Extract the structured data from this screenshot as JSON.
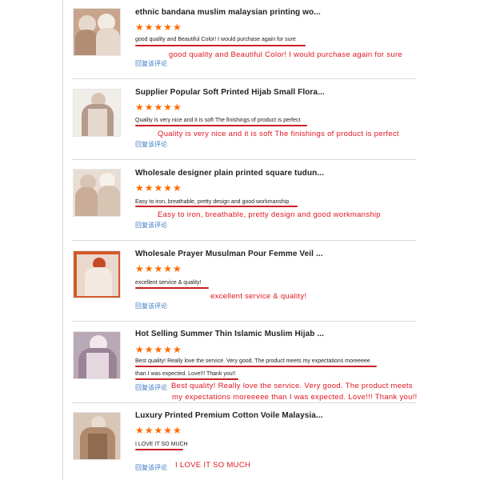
{
  "reviews": [
    {
      "title": "ethnic bandana muslim malaysian printing wo...",
      "stars": "★★★★★",
      "comment_lines": [
        "good quality and Beautiful Color! I would purchase again for sure"
      ],
      "reply": "回复该评论",
      "annotation_lines": [
        "good quality and Beautiful Color! I would purchase again for sure"
      ],
      "thumb_colors": {
        "bg": "#c9a58d",
        "a": "#e7d8cc",
        "b": "#b08d74",
        "c": "#f2ebe4"
      }
    },
    {
      "title": "Supplier Popular Soft Printed Hijab Small Flora...",
      "stars": "★★★★★",
      "comment_lines": [
        "Quality is very nice and it is soft The finishings of product is perfect"
      ],
      "reply": "回复该评论",
      "annotation_lines": [
        "Quality is very nice and it is soft The finishings of product is perfect"
      ],
      "thumb_colors": {
        "bg": "#f1ede8",
        "a": "#d7c4b7",
        "b": "#b59b8c",
        "c": "#ffffff"
      }
    },
    {
      "title": "Wholesale designer plain printed square tudun...",
      "stars": "★★★★★",
      "comment_lines": [
        "Easy to iron, breathable, pretty design and good workmanship"
      ],
      "reply": "回复该评论",
      "annotation_lines": [
        "Easy to iron, breathable, pretty design and good workmanship"
      ],
      "thumb_colors": {
        "bg": "#e9ddd3",
        "a": "#c9ad98",
        "b": "#d8c4b3",
        "c": "#f7f1ec"
      }
    },
    {
      "title": "Wholesale Prayer Musulman Pour Femme Veil ...",
      "stars": "★★★★★",
      "comment_lines": [
        "excellent service & quality!"
      ],
      "reply": "回复该评论",
      "annotation_lines": [
        "excellent service & quality!"
      ],
      "thumb_colors": {
        "bg": "#d25a2d",
        "a": "#f3e9e1",
        "b": "#c44a24",
        "c": "#e9d8cc"
      }
    },
    {
      "title": "Hot Selling Summer Thin Islamic Muslim Hijab ...",
      "stars": "★★★★★",
      "comment_lines": [
        "Best quality! Really love the service. Very good. The product meets my expectations moreeeee",
        "than I was expected. Love!!! Thank you!!"
      ],
      "reply": "回复该评论",
      "annotation_lines": [
        "Best quality! Really love the service. Very good. The product meets",
        "my expectations moreeeee than I was expected. Love!!! Thank you!!"
      ],
      "thumb_colors": {
        "bg": "#b9a9b6",
        "a": "#e4d7df",
        "b": "#9a8396",
        "c": "#f2e8ed"
      }
    },
    {
      "title": "Luxury Printed Premium Cotton Voile Malaysia...",
      "stars": "★★★★★",
      "comment_lines": [
        "I LOVE IT SO MUCH"
      ],
      "reply": "回复该评论",
      "annotation_lines": [
        "I LOVE IT SO MUCH"
      ],
      "thumb_colors": {
        "bg": "#d8c6b6",
        "a": "#b08a6d",
        "b": "#e9ddd1",
        "c": "#8f6b52"
      }
    }
  ],
  "colors": {
    "star": "#ff6a00",
    "annotation": "#e0161f",
    "reply": "#3b7bc0"
  }
}
